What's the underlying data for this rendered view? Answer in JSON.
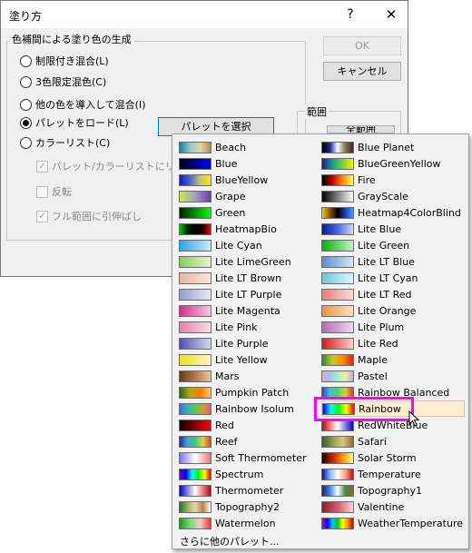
{
  "dialog": {
    "title": "塗り方",
    "help_label": "?",
    "close_label": "✕",
    "group_title": "色補間による塗り色の生成",
    "radios": [
      {
        "label": "制限付き混合(L)",
        "checked": false
      },
      {
        "label": "3色限定混色(C)",
        "checked": false
      },
      {
        "label": "他の色を導入して混合(I)",
        "checked": false
      },
      {
        "label": "パレットをロード(L)",
        "checked": true
      },
      {
        "label": "カラーリスト(C)",
        "checked": false
      }
    ],
    "checks": [
      {
        "label": "パレット/カラーリストにリン",
        "checked": true
      },
      {
        "label": "反転",
        "checked": false
      },
      {
        "label": "フル範囲に引伸ばし",
        "checked": true
      }
    ],
    "ok_label": "OK",
    "cancel_label": "キャンセル",
    "select_palette_label": "パレットを選択",
    "range_title": "範囲",
    "range_button_label": "全範囲"
  },
  "palette_menu": {
    "left_items": [
      {
        "label": "Beach",
        "icon": "beach-swatch"
      },
      {
        "label": "Blue",
        "icon": "blue-swatch"
      },
      {
        "label": "BlueYellow",
        "icon": "blueyellow-swatch"
      },
      {
        "label": "Grape",
        "icon": "grape-swatch"
      },
      {
        "label": "Green",
        "icon": "green-swatch"
      },
      {
        "label": "HeatmapBio",
        "icon": "heatmapbio-swatch"
      },
      {
        "label": "Lite Cyan",
        "icon": "lite-cyan-swatch"
      },
      {
        "label": "Lite LimeGreen",
        "icon": "lite-limegreen-swatch"
      },
      {
        "label": "Lite LT Brown",
        "icon": "lite-lt-brown-swatch"
      },
      {
        "label": "Lite LT Purple",
        "icon": "lite-lt-purple-swatch"
      },
      {
        "label": "Lite Magenta",
        "icon": "lite-magenta-swatch"
      },
      {
        "label": "Lite Pink",
        "icon": "lite-pink-swatch"
      },
      {
        "label": "Lite Purple",
        "icon": "lite-purple-swatch"
      },
      {
        "label": "Lite Yellow",
        "icon": "lite-yellow-swatch"
      },
      {
        "label": "Mars",
        "icon": "mars-swatch"
      },
      {
        "label": "Pumpkin Patch",
        "icon": "pumpkin-patch-swatch"
      },
      {
        "label": "Rainbow Isolum",
        "icon": "rainbow-isolum-swatch"
      },
      {
        "label": "Red",
        "icon": "red-swatch"
      },
      {
        "label": "Reef",
        "icon": "reef-swatch"
      },
      {
        "label": "Soft Thermometer",
        "icon": "soft-thermometer-swatch"
      },
      {
        "label": "Spectrum",
        "icon": "spectrum-swatch"
      },
      {
        "label": "Thermometer",
        "icon": "thermometer-swatch"
      },
      {
        "label": "Topography2",
        "icon": "topography2-swatch"
      },
      {
        "label": "Watermelon",
        "icon": "watermelon-swatch"
      }
    ],
    "right_items": [
      {
        "label": "Blue Planet",
        "icon": "blue-planet-swatch"
      },
      {
        "label": "BlueGreenYellow",
        "icon": "bluegreenyellow-swatch"
      },
      {
        "label": "Fire",
        "icon": "fire-swatch"
      },
      {
        "label": "GrayScale",
        "icon": "grayscale-swatch"
      },
      {
        "label": "Heatmap4ColorBlind",
        "icon": "heatmap4colorblind-swatch"
      },
      {
        "label": "Lite Blue",
        "icon": "lite-blue-swatch"
      },
      {
        "label": "Lite Green",
        "icon": "lite-green-swatch"
      },
      {
        "label": "Lite LT Blue",
        "icon": "lite-lt-blue-swatch"
      },
      {
        "label": "Lite LT Cyan",
        "icon": "lite-lt-cyan-swatch"
      },
      {
        "label": "Lite LT Red",
        "icon": "lite-lt-red-swatch"
      },
      {
        "label": "Lite Orange",
        "icon": "lite-orange-swatch"
      },
      {
        "label": "Lite Plum",
        "icon": "lite-plum-swatch"
      },
      {
        "label": "Lite Red",
        "icon": "lite-red-swatch"
      },
      {
        "label": "Maple",
        "icon": "maple-swatch"
      },
      {
        "label": "Pastel",
        "icon": "pastel-swatch"
      },
      {
        "label": "Rainbow Balanced",
        "icon": "rainbow-balanced-swatch"
      },
      {
        "label": "Rainbow",
        "icon": "rainbow-swatch",
        "highlighted": true
      },
      {
        "label": "RedWhiteBlue",
        "icon": "redwhiteblue-swatch"
      },
      {
        "label": "Safari",
        "icon": "safari-swatch"
      },
      {
        "label": "Solar Storm",
        "icon": "solar-storm-swatch"
      },
      {
        "label": "Temperature",
        "icon": "temperature-swatch"
      },
      {
        "label": "Topography1",
        "icon": "topography1-swatch"
      },
      {
        "label": "Valentine",
        "icon": "valentine-swatch"
      },
      {
        "label": "WeatherTemperature",
        "icon": "weathertemperature-swatch"
      }
    ],
    "more_label": "さらに他のパレット...",
    "highlight_color": "#ff00ff",
    "hover_color": "#ffeed0"
  }
}
